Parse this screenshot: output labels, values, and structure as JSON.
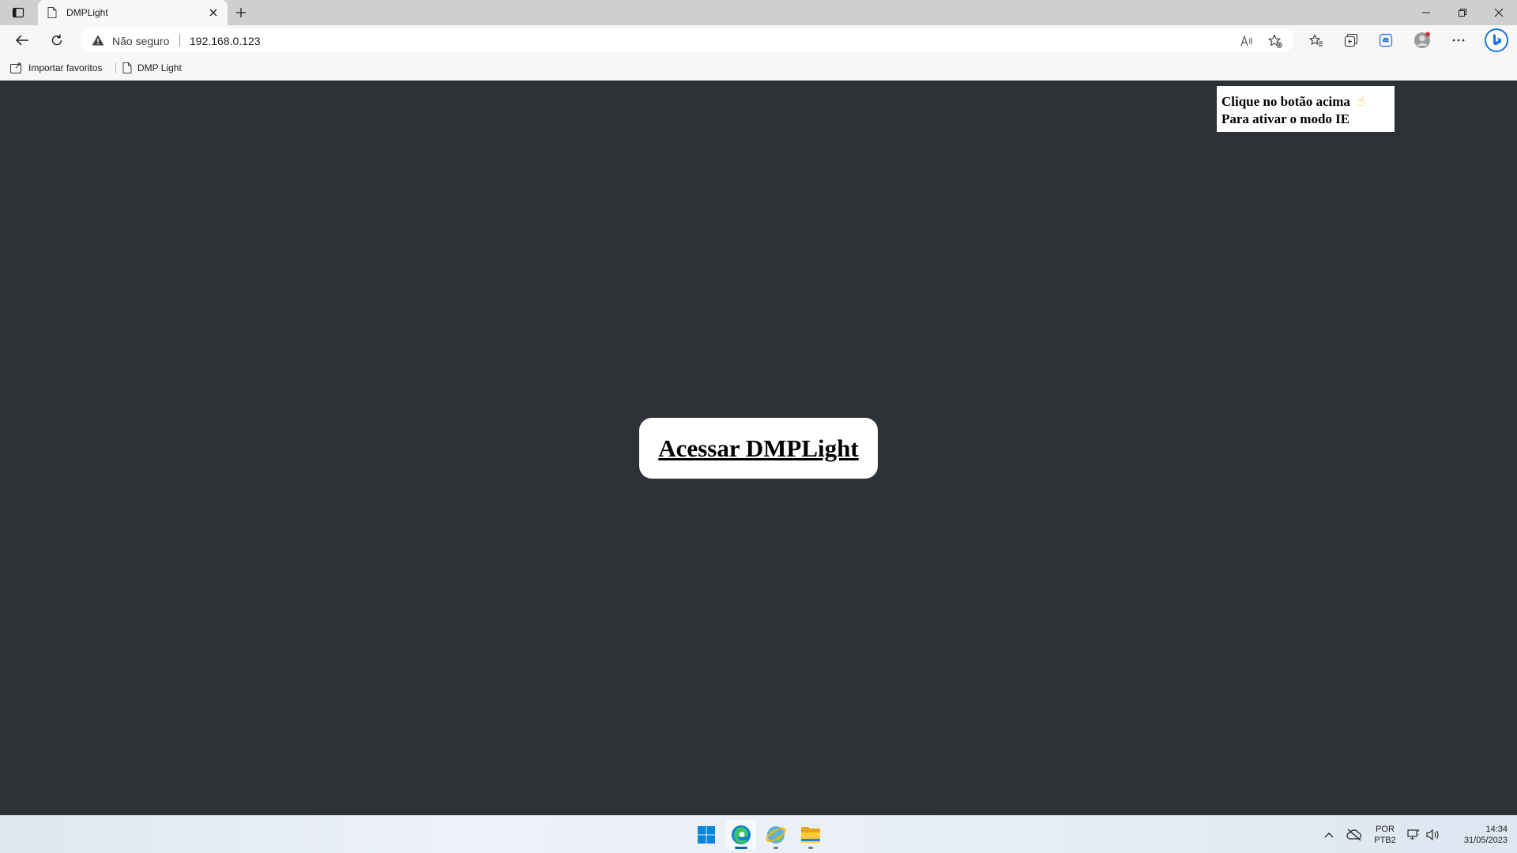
{
  "browser": {
    "tab": {
      "title": "DMPLight"
    },
    "address": {
      "security_text": "Não seguro",
      "url": "192.168.0.123"
    },
    "favorites": [
      {
        "label": "Importar favoritos"
      },
      {
        "label": "DMP Light"
      }
    ]
  },
  "page": {
    "ie_tip": {
      "line1": "Clique no botão acima",
      "pointer": "☝",
      "line2": "Para ativar o modo IE"
    },
    "main_button": {
      "label": "Acessar DMPLight"
    }
  },
  "taskbar": {
    "language": {
      "line1": "POR",
      "line2": "PTB2"
    },
    "clock": {
      "time": "14:34",
      "date": "31/05/2023"
    }
  },
  "colors": {
    "page_background": "#2e3236",
    "accent": "#0067c0",
    "edge_blue": "#1a73e8"
  }
}
